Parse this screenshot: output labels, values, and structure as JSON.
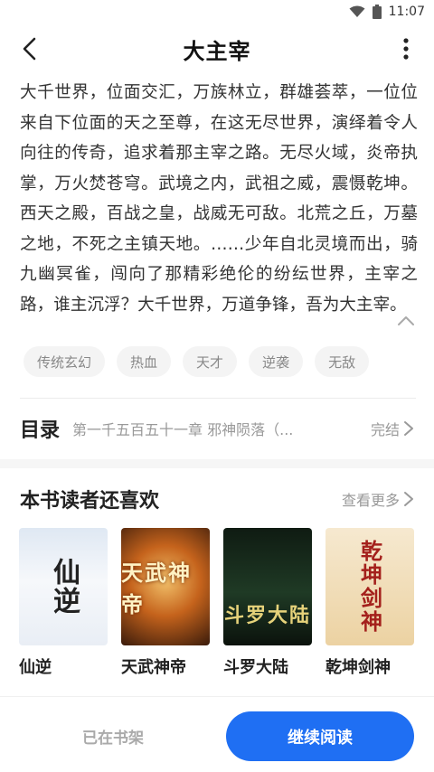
{
  "status_bar": {
    "time": "11:07",
    "icons": [
      "wifi-icon",
      "battery-icon"
    ]
  },
  "header": {
    "title": "大主宰",
    "back_icon": "back-arrow-icon",
    "more_icon": "more-vertical-icon"
  },
  "synopsis": {
    "text": "大千世界，位面交汇，万族林立，群雄荟萃，一位位来自下位面的天之至尊，在这无尽世界，演绎着令人向往的传奇，追求着那主宰之路。无尽火域，炎帝执掌，万火焚苍穹。武境之内，武祖之威，震慑乾坤。西天之殿，百战之皇，战威无可敌。北荒之丘，万墓之地，不死之主镇天地。……少年自北灵境而出，骑九幽冥雀，闯向了那精彩绝伦的纷纭世界，主宰之路，谁主沉浮？大千世界，万道争锋，吾为大主宰。",
    "collapse_icon": "chevron-up-icon"
  },
  "tags": [
    "传统玄幻",
    "热血",
    "天才",
    "逆袭",
    "无敌"
  ],
  "toc": {
    "label": "目录",
    "latest_chapter": "第一千五百五十一章 邪神陨落（...",
    "status": "完结"
  },
  "recommend": {
    "title": "本书读者还喜欢",
    "more": "查看更多",
    "books": [
      {
        "name": "仙逆",
        "cover_text": "仙逆"
      },
      {
        "name": "天武神帝",
        "cover_text": "天武神帝"
      },
      {
        "name": "斗罗大陆",
        "cover_text": "斗罗大陆"
      },
      {
        "name": "乾坤剑神",
        "cover_text": "乾坤剑神"
      }
    ]
  },
  "bottom": {
    "shelf_label": "已在书架",
    "read_label": "继续阅读",
    "accent": "#1f6ff3"
  }
}
